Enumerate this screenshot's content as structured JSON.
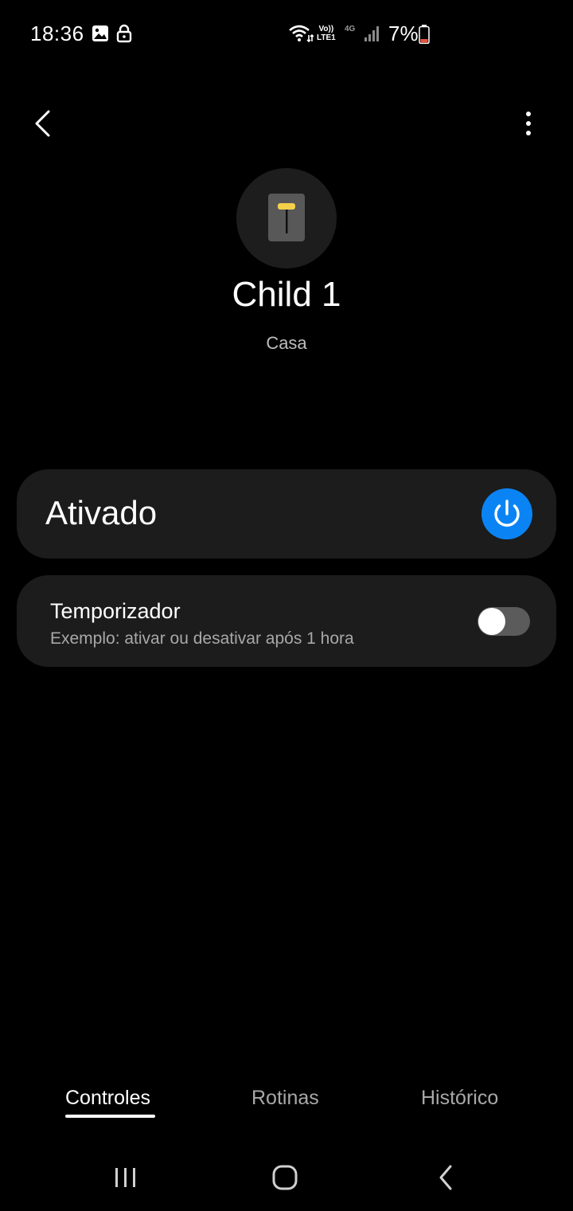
{
  "status_bar": {
    "time": "18:36",
    "battery_text": "7%",
    "volte_line1": "Vo))",
    "volte_line2": "LTE1",
    "network_type": "4G",
    "icons": [
      "gallery-icon",
      "lock-icon",
      "wifi-icon",
      "volte-icon",
      "signal-icon",
      "battery-icon"
    ],
    "battery_level": 0.07
  },
  "header": {
    "back_icon": "chevron-left-icon",
    "more_icon": "more-vertical-icon"
  },
  "device": {
    "icon": "switch-device-icon",
    "name": "Child 1",
    "room": "Casa"
  },
  "power_card": {
    "label": "Ativado",
    "state": "on",
    "button_icon": "power-icon",
    "accent_color": "#0a84f5"
  },
  "timer_card": {
    "title": "Temporizador",
    "subtitle": "Exemplo: ativar ou desativar após 1 hora",
    "toggle_state": "off"
  },
  "tabs": [
    {
      "label": "Controles",
      "active": true
    },
    {
      "label": "Rotinas",
      "active": false
    },
    {
      "label": "Histórico",
      "active": false
    }
  ],
  "system_nav": [
    "recents-icon",
    "home-icon",
    "back-icon"
  ],
  "colors": {
    "background": "#000000",
    "card": "#1c1c1c",
    "accent": "#0a84f5",
    "battery_low": "#e8533a",
    "device_indicator": "#f5d04a"
  }
}
